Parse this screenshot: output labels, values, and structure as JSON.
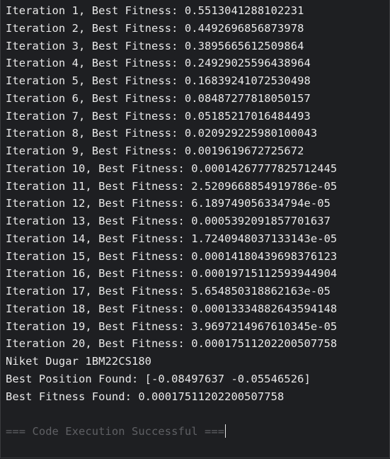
{
  "output": {
    "lines": [
      "Iteration 1, Best Fitness: 0.5513041288102231",
      "Iteration 2, Best Fitness: 0.4492696856873978",
      "Iteration 3, Best Fitness: 0.3895665612509864",
      "Iteration 4, Best Fitness: 0.24929025596438964",
      "Iteration 5, Best Fitness: 0.16839241072530498",
      "Iteration 6, Best Fitness: 0.08487277818050157",
      "Iteration 7, Best Fitness: 0.05185217016484493",
      "Iteration 8, Best Fitness: 0.020929225980100043",
      "Iteration 9, Best Fitness: 0.0019619672725672",
      "Iteration 10, Best Fitness: 0.00014267777825712445",
      "Iteration 11, Best Fitness: 2.5209668854919786e-05",
      "Iteration 12, Best Fitness: 6.189749056334794e-05",
      "Iteration 13, Best Fitness: 0.0005392091857701637",
      "Iteration 14, Best Fitness: 1.7240948037133143e-05",
      "Iteration 15, Best Fitness: 0.00014180439698376123",
      "Iteration 16, Best Fitness: 0.00019715112593944904",
      "Iteration 17, Best Fitness: 5.654850318862163e-05",
      "Iteration 18, Best Fitness: 0.00013334882643594148",
      "Iteration 19, Best Fitness: 3.9697214967610345e-05",
      "Iteration 20, Best Fitness: 0.00017511202200507758",
      "Niket Dugar 1BM22CS180",
      "Best Position Found: [-0.08497637 -0.05546526]",
      "Best Fitness Found: 0.00017511202200507758"
    ],
    "status": "=== Code Execution Successful ==="
  },
  "colors": {
    "background": "#1e1f22",
    "text": "#e9e9e9",
    "status": "#5f6064"
  }
}
